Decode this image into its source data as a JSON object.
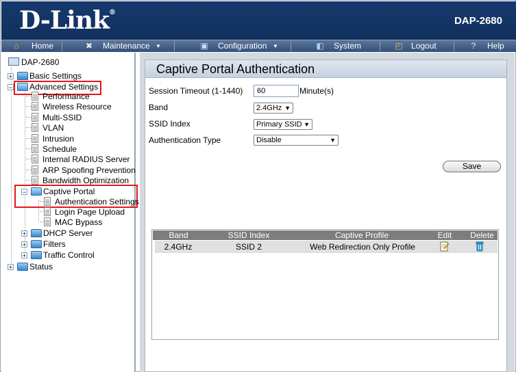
{
  "header": {
    "logo": "D-Link",
    "model": "DAP-2680"
  },
  "menu": [
    {
      "label": "Home",
      "icon": "home-icon"
    },
    {
      "label": "Maintenance",
      "icon": "tools-icon"
    },
    {
      "label": "Configuration",
      "icon": "disk-icon"
    },
    {
      "label": "System",
      "icon": "system-icon"
    },
    {
      "label": "Logout",
      "icon": "logout-icon"
    },
    {
      "label": "Help",
      "icon": "help-icon"
    }
  ],
  "tree": {
    "root": "DAP-2680",
    "basic": "Basic Settings",
    "advanced": "Advanced Settings",
    "advanced_items": [
      "Performance",
      "Wireless Resource",
      "Multi-SSID",
      "VLAN",
      "Intrusion",
      "Schedule",
      "Internal RADIUS Server",
      "ARP Spoofing Prevention",
      "Bandwidth Optimization"
    ],
    "captive": "Captive Portal",
    "captive_items": [
      "Authentication Settings",
      "Login Page Upload",
      "MAC Bypass"
    ],
    "dhcp": "DHCP Server",
    "filters": "Filters",
    "traffic": "Traffic Control",
    "status": "Status"
  },
  "panel": {
    "title": "Captive Portal Authentication",
    "session_label": "Session Timeout (1-1440)",
    "session_value": "60",
    "session_unit": "Minute(s)",
    "band_label": "Band",
    "band_value": "2.4GHz",
    "ssid_label": "SSID Index",
    "ssid_value": "Primary SSID",
    "auth_label": "Authentication Type",
    "auth_value": "Disable",
    "save": "Save"
  },
  "table": {
    "headers": [
      "Band",
      "SSID Index",
      "Captive Profile",
      "Edit",
      "Delete"
    ],
    "rows": [
      {
        "band": "2.4GHz",
        "ssid": "SSID 2",
        "profile": "Web Redirection Only Profile"
      }
    ]
  }
}
